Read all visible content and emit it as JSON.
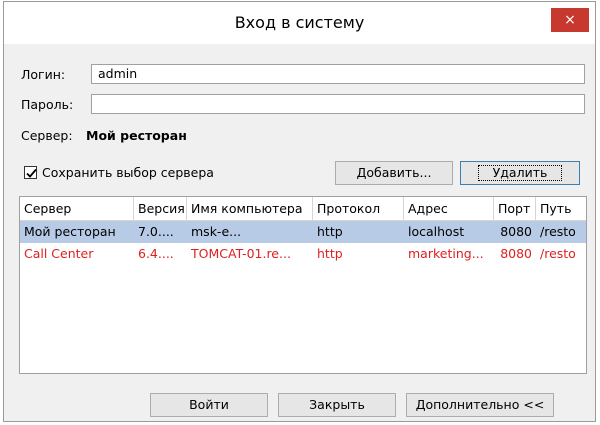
{
  "window": {
    "title": "Вход в систему",
    "close_symbol": "×",
    "close_color": "#c7392f"
  },
  "form": {
    "login_label": "Логин:",
    "login_value": "admin",
    "password_label": "Пароль:",
    "password_value": "",
    "server_label": "Сервер:",
    "server_value": "Мой ресторан"
  },
  "options": {
    "save_server_label": "Сохранить выбор сервера",
    "save_server_checked": true,
    "add_label": "Добавить...",
    "delete_label": "Удалить"
  },
  "table": {
    "columns": [
      "Сервер",
      "Версия",
      "Имя компьютера",
      "Протокол",
      "Адрес",
      "Порт",
      "Путь"
    ],
    "rows": [
      [
        "Мой ресторан",
        "7.0....",
        "msk-e...",
        "http",
        "localhost",
        "8080",
        "/resto"
      ],
      [
        "Call Center",
        "6.4....",
        "TOMCAT-01.re...",
        "http",
        "marketing...",
        "8080",
        "/resto"
      ]
    ],
    "selected_row": 0,
    "highlight_color": "#e02020"
  },
  "footer": {
    "login_button": "Войти",
    "close_button": "Закрыть",
    "advanced_button": "Дополнительно <<"
  }
}
